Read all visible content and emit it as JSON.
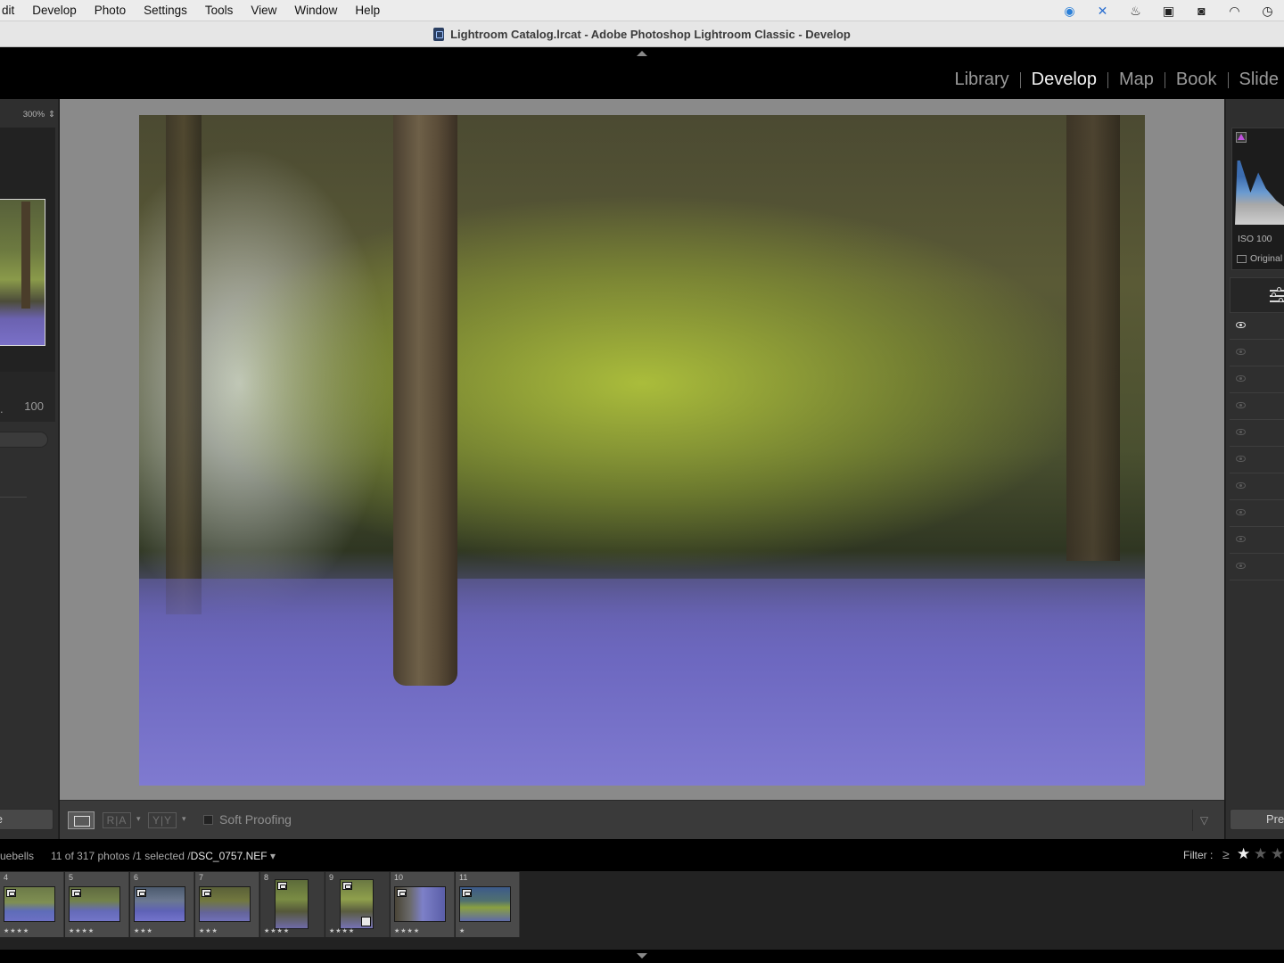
{
  "menubar": {
    "items": [
      "dit",
      "Develop",
      "Photo",
      "Settings",
      "Tools",
      "View",
      "Window",
      "Help"
    ]
  },
  "window": {
    "title": "Lightroom Catalog.lrcat - Adobe Photoshop Lightroom Classic - Develop"
  },
  "modules": {
    "items": [
      {
        "label": "Library",
        "active": false
      },
      {
        "label": "Develop",
        "active": true
      },
      {
        "label": "Map",
        "active": false
      },
      {
        "label": "Book",
        "active": false
      },
      {
        "label": "Slide",
        "active": false
      }
    ]
  },
  "navigator": {
    "zoom_label": "300%"
  },
  "left_panel": {
    "value": "100",
    "button_label": "te"
  },
  "toolbar": {
    "before_after_label": "R|A",
    "compare_label": "Y|Y",
    "soft_proofing_label": "Soft Proofing"
  },
  "right_panel": {
    "iso_label": "ISO 100",
    "original_label": "Original",
    "previous_button_label": "Pre"
  },
  "filmstrip_header": {
    "source_label": "uebells",
    "count_label": "11 of 317 photos /1 selected /",
    "filename": "DSC_0757.NEF",
    "filter_label": "Filter :",
    "gte_symbol": "≥"
  },
  "filmstrip": {
    "cells": [
      {
        "number": "4",
        "stars": "★★★★",
        "orientation": "land",
        "bg": "bg-bluebells1"
      },
      {
        "number": "5",
        "stars": "★★★★",
        "orientation": "land",
        "bg": "bg-bluebells2"
      },
      {
        "number": "6",
        "stars": "★★★",
        "orientation": "land",
        "bg": "bg-bluebells3"
      },
      {
        "number": "7",
        "stars": "★★★",
        "orientation": "land",
        "bg": "bg-forest"
      },
      {
        "number": "8",
        "stars": "★★★★",
        "orientation": "port",
        "bg": "bg-tree1"
      },
      {
        "number": "9",
        "stars": "★★★★",
        "orientation": "port",
        "bg": "bg-tree2"
      },
      {
        "number": "10",
        "stars": "★★★★",
        "orientation": "land",
        "bg": "bg-tree3"
      },
      {
        "number": "11",
        "stars": "★",
        "orientation": "land",
        "bg": "bg-tree4"
      }
    ]
  },
  "colors": {
    "active_module": "#f2f2f2",
    "inactive_module": "#9a9a9a",
    "clipping_indicator": "#c050e0"
  }
}
